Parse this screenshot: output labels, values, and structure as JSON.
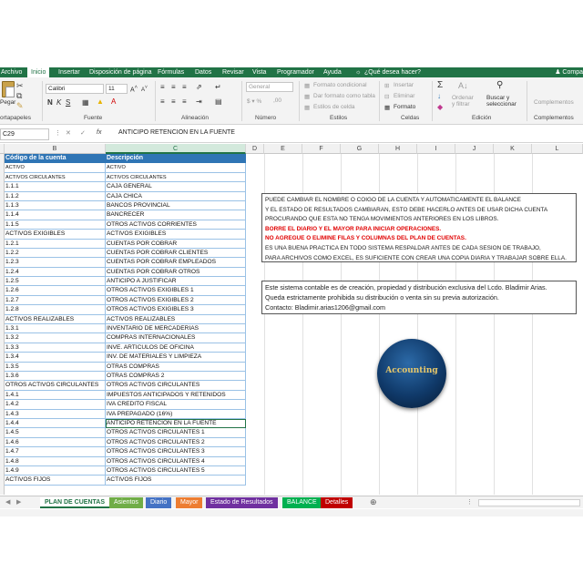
{
  "ribbon_tabs": [
    {
      "label": "Archivo"
    },
    {
      "label": "Inicio",
      "active": true
    },
    {
      "label": "Insertar"
    },
    {
      "label": "Disposición de página"
    },
    {
      "label": "Fórmulas"
    },
    {
      "label": "Datos"
    },
    {
      "label": "Revisar"
    },
    {
      "label": "Vista"
    },
    {
      "label": "Programador"
    },
    {
      "label": "Ayuda"
    },
    {
      "label": "¿Qué desea hacer?",
      "icon": "lightbulb-icon"
    }
  ],
  "share_label": "Compa",
  "ribbon": {
    "clipboard": {
      "paste_label": "Pegar",
      "group_label": "ortapapeles"
    },
    "font": {
      "font_name": "Calibri",
      "font_size": "11",
      "group_label": "Fuente"
    },
    "alignment": {
      "group_label": "Alineación"
    },
    "number": {
      "format": "General",
      "group_label": "Número"
    },
    "styles": {
      "conditional_format": "Formato condicional",
      "format_as_table": "Dar formato como tabla",
      "cell_styles": "Estilos de celda",
      "group_label": "Estilos"
    },
    "cells": {
      "insert": "Insertar",
      "delete": "Eliminar",
      "format": "Formato",
      "group_label": "Celdas"
    },
    "editing": {
      "sort_filter": "Ordenar y filtrar",
      "find_select": "Buscar y seleccionar",
      "group_label": "Edición"
    },
    "addins": {
      "label": "Complementos",
      "group_label": "Complementos"
    }
  },
  "formula_bar": {
    "name_box": "C29",
    "fx": "fx",
    "content": "ANTICIPO RETENCION EN LA FUENTE"
  },
  "columns": [
    "B",
    "C",
    "D",
    "E",
    "F",
    "G",
    "H",
    "I",
    "J",
    "K",
    "L"
  ],
  "selected_column": "C",
  "table": {
    "headers": [
      "Código de la cuenta",
      "Descripción"
    ],
    "rows": [
      [
        "ACTIVO",
        "ACTIVO"
      ],
      [
        "ACTIVOS CIRCULANTES",
        "ACTIVOS CIRCULANTES"
      ],
      [
        "1.1.1",
        "CAJA GENERAL"
      ],
      [
        "1.1.2",
        "CAJA CHICA"
      ],
      [
        "1.1.3",
        "BANCOS PROVINCIAL"
      ],
      [
        "1.1.4",
        "BANCRECER"
      ],
      [
        "1.1.5",
        "OTROS ACTIVOS CORRIENTES"
      ],
      [
        "ACTIVOS EXIGIBLES",
        "ACTIVOS EXIGIBLES"
      ],
      [
        "1.2.1",
        "CUENTAS POR COBRAR"
      ],
      [
        "1.2.2",
        "CUENTAS POR COBRAR CLIENTES"
      ],
      [
        "1.2.3",
        "CUENTAS POR COBRAR EMPLEADOS"
      ],
      [
        "1.2.4",
        "CUENTAS POR COBRAR OTROS"
      ],
      [
        "1.2.5",
        "ANTICIPO A JUSTIFICAR"
      ],
      [
        "1.2.6",
        "OTROS ACTIVOS EXIGIBLES 1"
      ],
      [
        "1.2.7",
        "OTROS ACTIVOS EXIGIBLES 2"
      ],
      [
        "1.2.8",
        "OTROS ACTIVOS EXIGIBLES 3"
      ],
      [
        "ACTIVOS REALIZABLES",
        "ACTIVOS REALIZABLES"
      ],
      [
        "1.3.1",
        "INVENTARIO DE MERCADERIAS"
      ],
      [
        "1.3.2",
        "COMPRAS INTERNACIONALES"
      ],
      [
        "1.3.3",
        "INVE. ARTICULOS DE OFICINA"
      ],
      [
        "1.3.4",
        "INV. DE MATERIALES Y LIMPIEZA"
      ],
      [
        "1.3.5",
        "OTRAS COMPRAS"
      ],
      [
        "1.3.6",
        "OTRAS COMPRAS 2"
      ],
      [
        "OTROS ACTIVOS CIRCULANTES",
        "OTROS ACTIVOS CIRCULANTES"
      ],
      [
        "1.4.1",
        "IMPUESTOS ANTICIPADOS Y RETENIDOS"
      ],
      [
        "1.4.2",
        "IVA CREDITO FISCAL"
      ],
      [
        "1.4.3",
        "IVA PREPAGADO (16%)"
      ],
      [
        "1.4.4",
        "ANTICIPO RETENCION EN LA FUENTE"
      ],
      [
        "1.4.5",
        "OTROS ACTIVOS CIRCULANTES 1"
      ],
      [
        "1.4.6",
        "OTROS ACTIVOS CIRCULANTES 2"
      ],
      [
        "1.4.7",
        "OTROS ACTIVOS CIRCULANTES 3"
      ],
      [
        "1.4.8",
        "OTROS ACTIVOS CIRCULANTES 4"
      ],
      [
        "1.4.9",
        "OTROS ACTIVOS CIRCULANTES 5"
      ],
      [
        "ACTIVOS FIJOS",
        "ACTIVOS FIJOS"
      ]
    ]
  },
  "notice1": {
    "lines": [
      {
        "text": "PUEDE CAMBIAR EL NOMBRE O COIGO DE LA CUENTA Y AUTOMATICAMENTE EL BALANCE",
        "red": false
      },
      {
        "text": "Y EL ESTADO DE RESULTADOS CAMBIARAN, ESTO DEBE HACERLO ANTES DE USAR DICHA CUENTA",
        "red": false
      },
      {
        "text": "PROCURANDO QUE ESTA NO TENGA MOVIMIENTOS ANTERIORES EN LOS LIBROS.",
        "red": false
      },
      {
        "text": "BORRE EL DIARIO Y EL MAYOR PARA INICIAR OPERACIONES.",
        "red": true
      },
      {
        "text": "NO AGREGUE O ELIMINE FILAS Y COLUMNAS DEL PLAN DE CUENTAS.",
        "red": true
      },
      {
        "text": "ES UNA BUENA PRACTICA EN TODO SISTEMA RESPALDAR ANTES DE CADA SESION DE TRABAJO,",
        "red": false
      },
      {
        "text": "PARA ARCHIVOS COMO EXCEL, ES SUFICIENTE CON CREAR UNA COPIA DIARIA Y TRABAJAR SOBRE ELLA.",
        "red": false
      }
    ]
  },
  "notice2": {
    "lines": [
      "Este sistema contable es de creación, propiedad y distribución exclusiva del Lcdo. Bladimir Arias.",
      "Queda estrictamente prohibida su distribución o venta sin su previa autorización.",
      "Contacto: Bladimir.arias1206@gmail.com"
    ]
  },
  "logo_text": "Accounting",
  "sheet_tabs": [
    {
      "label": "PLAN DE CUENTAS",
      "color": "#ffffff",
      "text": "#217346",
      "active": true
    },
    {
      "label": "Asientos",
      "color": "#70ad47",
      "text": "#ffffff"
    },
    {
      "label": "Diario",
      "color": "#4472c4",
      "text": "#ffffff"
    },
    {
      "label": "Mayor",
      "color": "#ed7d31",
      "text": "#ffffff"
    },
    {
      "label": "Estado de Resultados",
      "color": "#7030a0",
      "text": "#ffffff"
    },
    {
      "label": "BALANCE",
      "color": "#00b050",
      "text": "#ffffff"
    },
    {
      "label": "Detalles",
      "color": "#c00000",
      "text": "#ffffff"
    }
  ],
  "colors": {
    "excel_green": "#217346",
    "header_blue": "#2f75b5",
    "notice_red": "#e00000"
  }
}
